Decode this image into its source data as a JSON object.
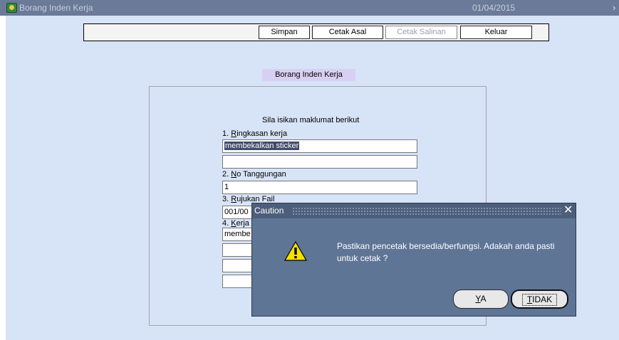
{
  "window": {
    "title": "Borang Inden Kerja",
    "date": "01/04/2015",
    "more_glyph": "›",
    "icon": "form-app-icon"
  },
  "toolbar": {
    "simpan": "Simpan",
    "cetak_asal": "Cetak Asal",
    "cetak_salinan": "Cetak Salinan",
    "keluar": "Keluar"
  },
  "form": {
    "heading": "Borang Inden Kerja",
    "instruction": "Sila isikan maklumat berikut",
    "fields": [
      {
        "label_num": "1. ",
        "label_key": "R",
        "label_rest": "ingkasan kerja",
        "values": [
          "membekalkan sticker",
          ""
        ]
      },
      {
        "label_num": "2. ",
        "label_key": "N",
        "label_rest": "o Tanggungan",
        "values": [
          "1"
        ]
      },
      {
        "label_num": "3. ",
        "label_key": "R",
        "label_rest": "ujukan Fail",
        "values": [
          "001/00"
        ]
      },
      {
        "label_num": "4. ",
        "label_key": "K",
        "label_rest": "erja te",
        "values": [
          "membe",
          "",
          "",
          ""
        ]
      }
    ]
  },
  "dialog": {
    "title": "Caution",
    "close_glyph": "✕",
    "message": "Pastikan pencetak bersedia/berfungsi. Adakah anda pasti untuk cetak ?",
    "yes_key": "Y",
    "yes_rest": "A",
    "no_key": "T",
    "no_rest": "IDAK",
    "icon": "warning-icon"
  },
  "colors": {
    "titlebar": "#6b7a98",
    "workarea": "#d7e3f7",
    "dialog": "#5f7596",
    "heading_highlight": "#d8d0f4",
    "selection": "#404b6a"
  }
}
